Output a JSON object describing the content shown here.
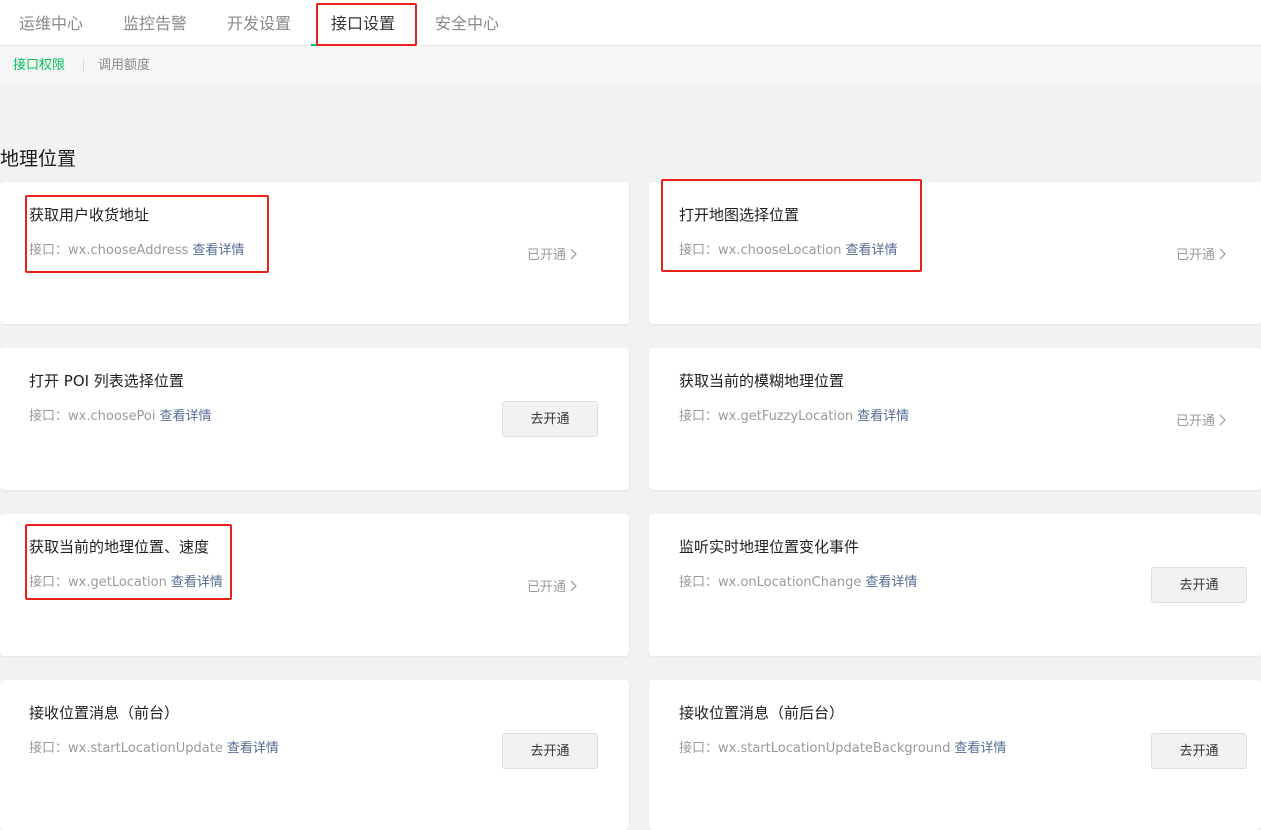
{
  "top_tabs": [
    {
      "label": "运维中心"
    },
    {
      "label": "监控告警"
    },
    {
      "label": "开发设置"
    },
    {
      "label": "接口设置"
    },
    {
      "label": "安全中心"
    }
  ],
  "sub_tabs": [
    {
      "label": "接口权限"
    },
    {
      "label": "调用额度"
    }
  ],
  "section": {
    "title": "地理位置"
  },
  "api_prefix": "接口：",
  "detail_label": "查看详情",
  "enabled_label": "已开通",
  "open_label": "去开通",
  "cards": [
    {
      "title": "获取用户收货地址",
      "api": "wx.chooseAddress",
      "status": "enabled"
    },
    {
      "title": "打开地图选择位置",
      "api": "wx.chooseLocation",
      "status": "enabled"
    },
    {
      "title": "打开 POI 列表选择位置",
      "api": "wx.choosePoi",
      "status": "not_enabled"
    },
    {
      "title": "获取当前的模糊地理位置",
      "api": "wx.getFuzzyLocation",
      "status": "enabled"
    },
    {
      "title": "获取当前的地理位置、速度",
      "api": "wx.getLocation",
      "status": "enabled"
    },
    {
      "title": "监听实时地理位置变化事件",
      "api": "wx.onLocationChange",
      "status": "not_enabled"
    },
    {
      "title": "接收位置消息（前台）",
      "api": "wx.startLocationUpdate",
      "status": "not_enabled"
    },
    {
      "title": "接收位置消息（前后台）",
      "api": "wx.startLocationUpdateBackground",
      "status": "not_enabled"
    }
  ],
  "colors": {
    "accent": "#07c160",
    "link": "#576b95",
    "highlight": "#e8231b"
  }
}
